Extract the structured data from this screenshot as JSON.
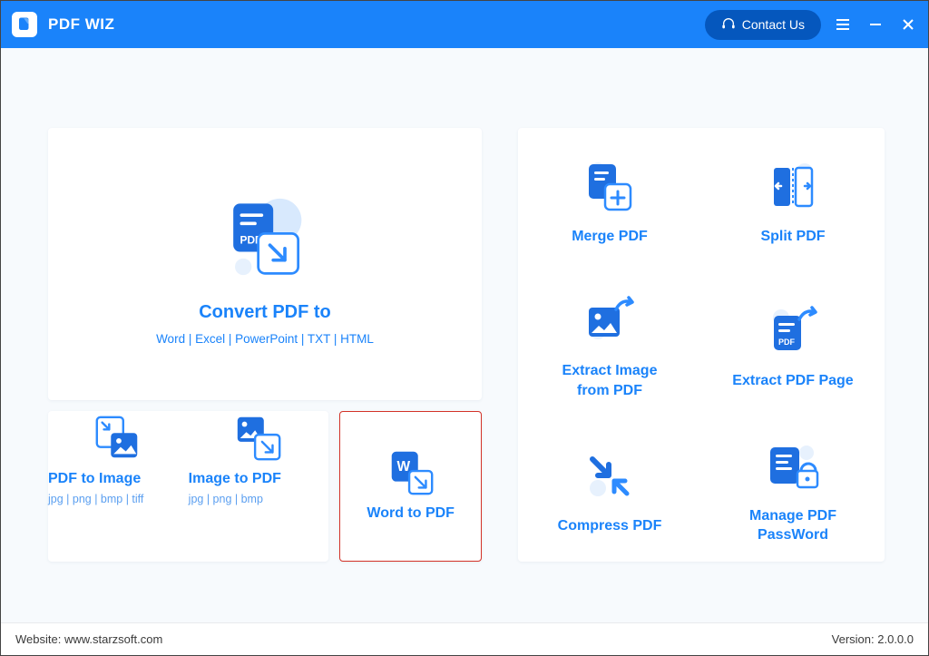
{
  "header": {
    "app_title": "PDF WIZ",
    "contact_label": "Contact Us"
  },
  "hero": {
    "title": "Convert PDF to",
    "subtitle": "Word | Excel | PowerPoint | TXT | HTML"
  },
  "bottom_tools": [
    {
      "title": "PDF to Image",
      "subtitle": "jpg | png | bmp | tiff"
    },
    {
      "title": "Image to PDF",
      "subtitle": "jpg | png | bmp"
    },
    {
      "title": "Word to PDF",
      "subtitle": ""
    }
  ],
  "right_tools": [
    {
      "label": "Merge PDF"
    },
    {
      "label": "Split PDF"
    },
    {
      "label": "Extract Image\nfrom PDF"
    },
    {
      "label": "Extract PDF Page"
    },
    {
      "label": "Compress PDF"
    },
    {
      "label": "Manage PDF\nPassWord"
    }
  ],
  "footer": {
    "website_label": "Website: www.starzsoft.com",
    "version_label": "Version: 2.0.0.0"
  }
}
